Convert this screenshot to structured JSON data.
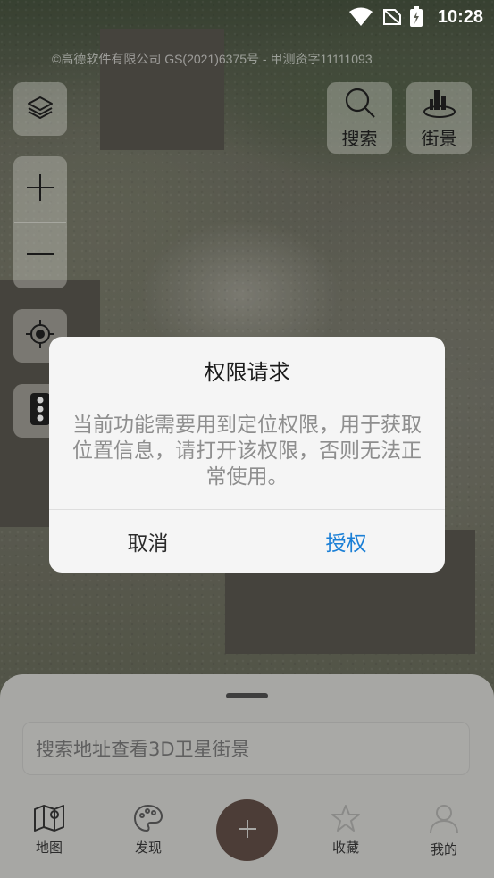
{
  "status_bar": {
    "time": "10:28"
  },
  "map": {
    "attribution": "©高德软件有限公司 GS(2021)6375号 - 甲测资字11111093"
  },
  "controls": {
    "search_label": "搜索",
    "street_label": "街景"
  },
  "dialog": {
    "title": "权限请求",
    "message": "当前功能需要用到定位权限，用于获取位置信息，请打开该权限，否则无法正常使用。",
    "cancel_label": "取消",
    "confirm_label": "授权"
  },
  "bottom": {
    "search_placeholder": "搜索地址查看3D卫星街景",
    "tabs": [
      {
        "label": "地图",
        "icon": "map-icon"
      },
      {
        "label": "发现",
        "icon": "palette-icon"
      },
      {
        "label": "收藏",
        "icon": "star-icon"
      },
      {
        "label": "我的",
        "icon": "person-icon"
      }
    ],
    "fab_icon": "plus-icon"
  },
  "colors": {
    "accent": "#1a7fd6",
    "fab": "#4c3d37",
    "dialog_bg": "#f5f5f5",
    "sheet_bg": "#a7a7a4"
  }
}
